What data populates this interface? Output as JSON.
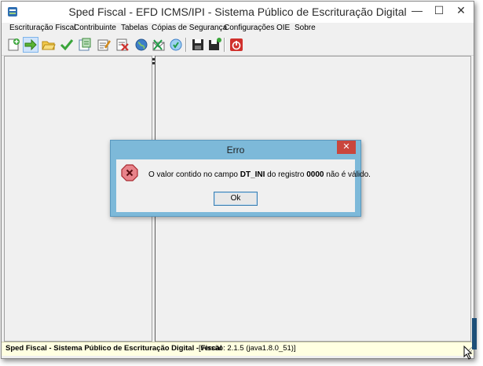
{
  "window": {
    "title": "Sped Fiscal - EFD ICMS/IPI - Sistema Público de Escrituração Digital",
    "controls": {
      "minimize": "—",
      "maximize": "☐",
      "close": "✕"
    }
  },
  "menu": {
    "items": [
      "Escrituração Fiscal",
      "Contribuinte",
      "Tabelas",
      "Cópias de Segurança",
      "Configurações",
      "OIE",
      "Sobre"
    ]
  },
  "toolbar": {
    "buttons": [
      "new-icon",
      "import-icon",
      "open-folder-icon",
      "validate-check-icon",
      "report-icon",
      "sign-icon",
      "delete-icon",
      "globe-icon",
      "transmit-icon",
      "receipt-icon",
      "save-icon",
      "save-as-icon",
      "exit-icon"
    ],
    "active_button": "import-icon"
  },
  "statusbar": {
    "bold_text": "Sped Fiscal - Sistema Público de Escrituração Digital - Fiscal",
    "version_text": "[versão: 2.1.5 (java1.8.0_51)]"
  },
  "dialog": {
    "title": "Erro",
    "close": "✕",
    "message_prefix": "O valor contido no campo ",
    "field": "DT_INI",
    "message_middle": " do registro ",
    "record": "0000",
    "message_suffix": " não é válido.",
    "ok_label": "Ok"
  },
  "colors": {
    "dialog_frame": "#7db9d9",
    "close_button": "#c9463d",
    "statusbar_bg": "#ffffe1"
  }
}
